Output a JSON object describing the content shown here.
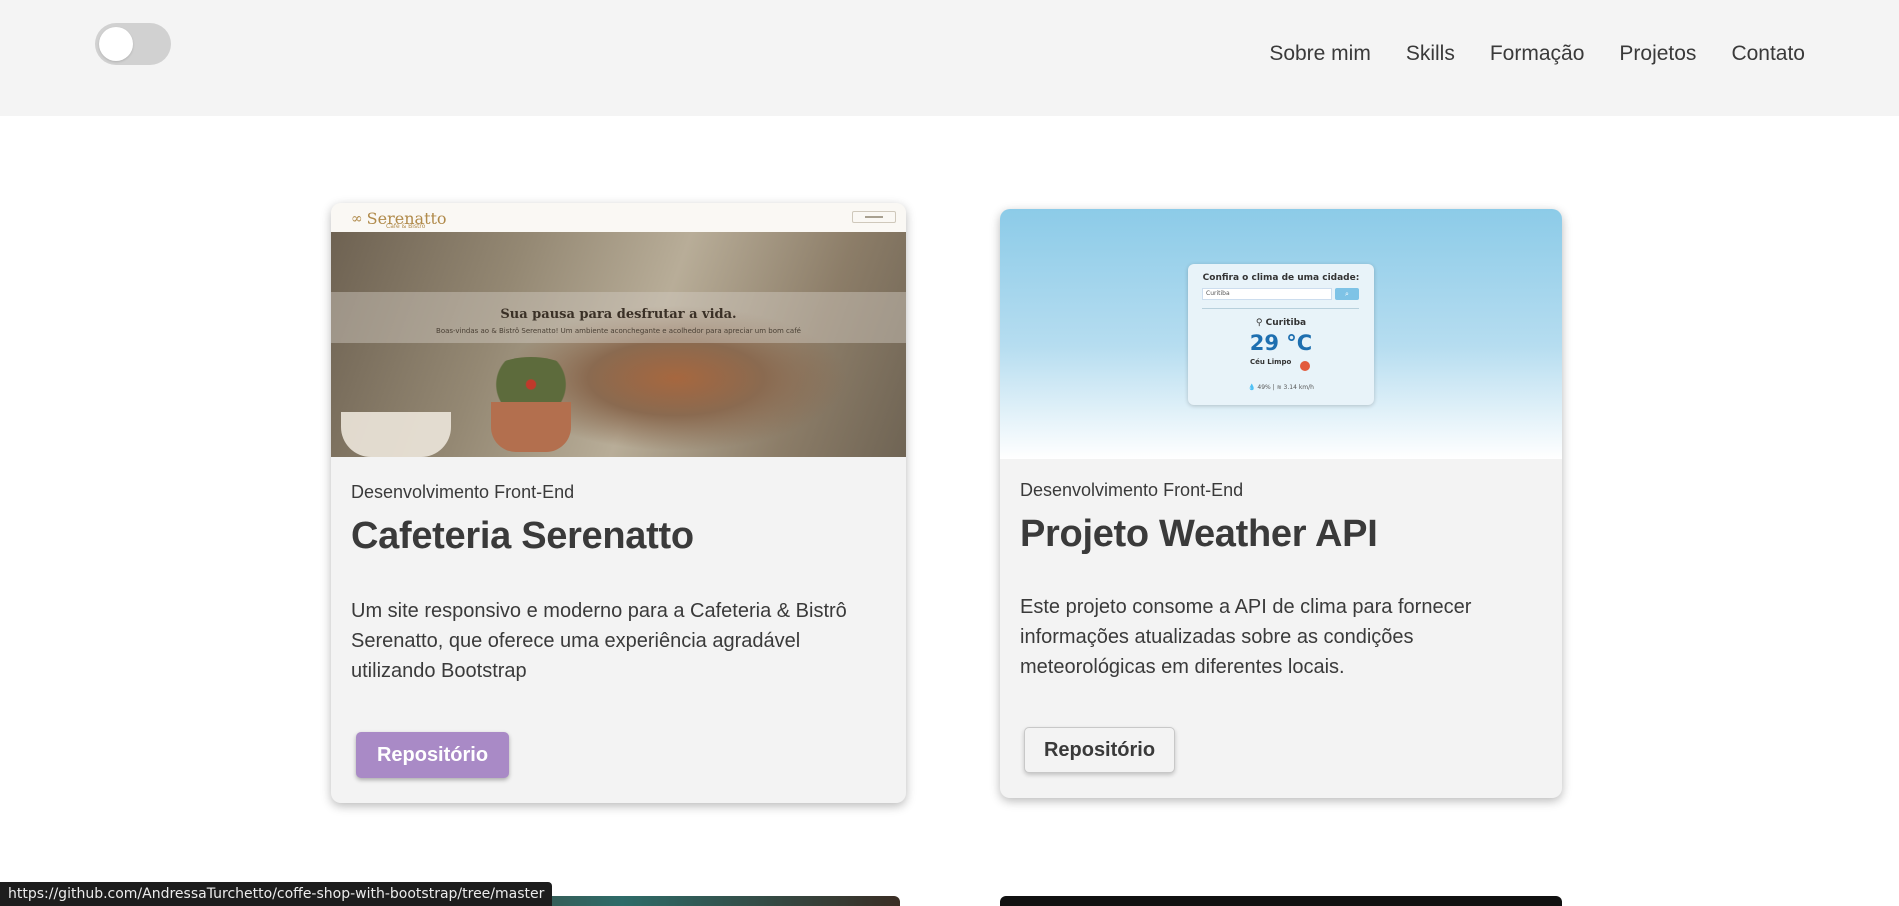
{
  "nav": {
    "theme_toggle": "off",
    "links": [
      "Sobre mim",
      "Skills",
      "Formação",
      "Projetos",
      "Contato"
    ]
  },
  "projects": [
    {
      "category": "Desenvolvimento Front-End",
      "title": "Cafeteria Serenatto",
      "description": "Um site responsivo e moderno para a Cafeteria & Bistrô Serenatto, que oferece uma experiência agradável utilizando Bootstrap",
      "button": "Repositório",
      "preview": {
        "logo": "Serenatto",
        "logo_sub": "Café & Bistrô",
        "headline": "Sua pausa para desfrutar a vida.",
        "subline": "Boas-vindas ao & Bistrô Serenatto! Um ambiente aconchegante e acolhedor para apreciar um bom café"
      }
    },
    {
      "category": "Desenvolvimento Front-End",
      "title": "Projeto Weather API",
      "description": "Este projeto consome a API de clima para fornecer informações atualizadas sobre as condições meteorológicas em diferentes locais.",
      "button": "Repositório",
      "preview": {
        "label": "Confira o clima de uma cidade:",
        "input_value": "Curitiba",
        "city": "Curitiba",
        "temp": "29 °C",
        "condition": "Céu Limpo",
        "humidity": "49%",
        "wind": "3.14 km/h"
      }
    }
  ],
  "status_bar": "https://github.com/AndressaTurchetto/coffe-shop-with-bootstrap/tree/master"
}
